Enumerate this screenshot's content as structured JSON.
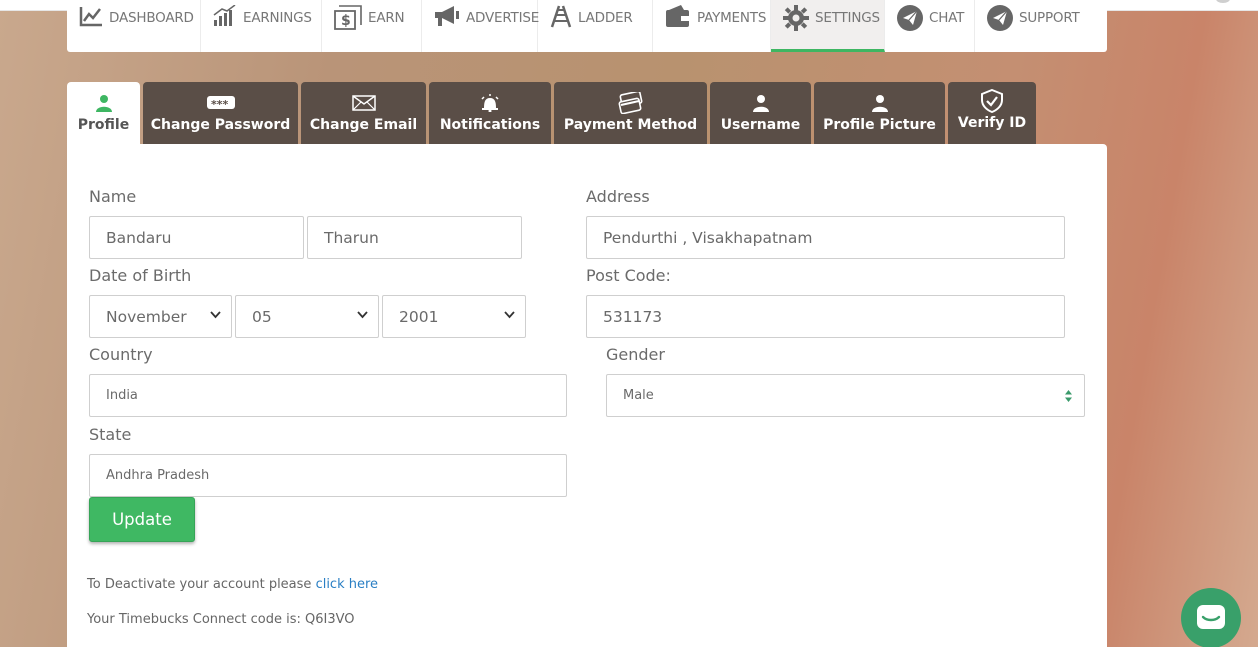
{
  "nav": {
    "items": [
      {
        "label": "DASHBOARD",
        "icon": "dashboard-chart-icon"
      },
      {
        "label": "EARNINGS",
        "icon": "bar-chart-icon"
      },
      {
        "label": "EARN",
        "icon": "dollar-icon"
      },
      {
        "label": "ADVERTISE",
        "icon": "megaphone-icon"
      },
      {
        "label": "LADDER",
        "icon": "ladder-icon"
      },
      {
        "label": "PAYMENTS",
        "icon": "wallet-icon"
      },
      {
        "label": "SETTINGS",
        "icon": "gear-icon"
      },
      {
        "label": "CHAT",
        "icon": "paper-plane-icon"
      },
      {
        "label": "SUPPORT",
        "icon": "paper-plane-icon"
      }
    ],
    "active": "SETTINGS"
  },
  "tabs": [
    {
      "label": "Profile",
      "icon": "user-icon"
    },
    {
      "label": "Change Password",
      "icon": "password-icon"
    },
    {
      "label": "Change Email",
      "icon": "envelope-icon"
    },
    {
      "label": "Notifications",
      "icon": "alarm-bell-icon"
    },
    {
      "label": "Payment Method",
      "icon": "cards-icon"
    },
    {
      "label": "Username",
      "icon": "user-icon"
    },
    {
      "label": "Profile Picture",
      "icon": "user-icon"
    },
    {
      "label": "Verify ID",
      "icon": "shield-check-icon"
    }
  ],
  "form": {
    "name_label": "Name",
    "first_name": "Bandaru",
    "last_name": "Tharun",
    "dob_label": "Date of Birth",
    "dob_month": "November",
    "dob_day": "05",
    "dob_year": "2001",
    "country_label": "Country",
    "country": "India",
    "state_label": "State",
    "state": "Andhra Pradesh",
    "address_label": "Address",
    "address": "Pendurthi , Visakhapatnam",
    "postcode_label": "Post Code:",
    "postcode": "531173",
    "gender_label": "Gender",
    "gender": "Male",
    "update_label": "Update"
  },
  "footer": {
    "deactivate_text": "To Deactivate your account please",
    "deactivate_link": "click here",
    "connect_text": "Your Timebucks Connect code is: Q6I3VO"
  },
  "colors": {
    "accent_green": "#3fb863",
    "tab_dark": "#5a4e47",
    "link_blue": "#2a7fc4",
    "chat_green": "#39a06a"
  }
}
